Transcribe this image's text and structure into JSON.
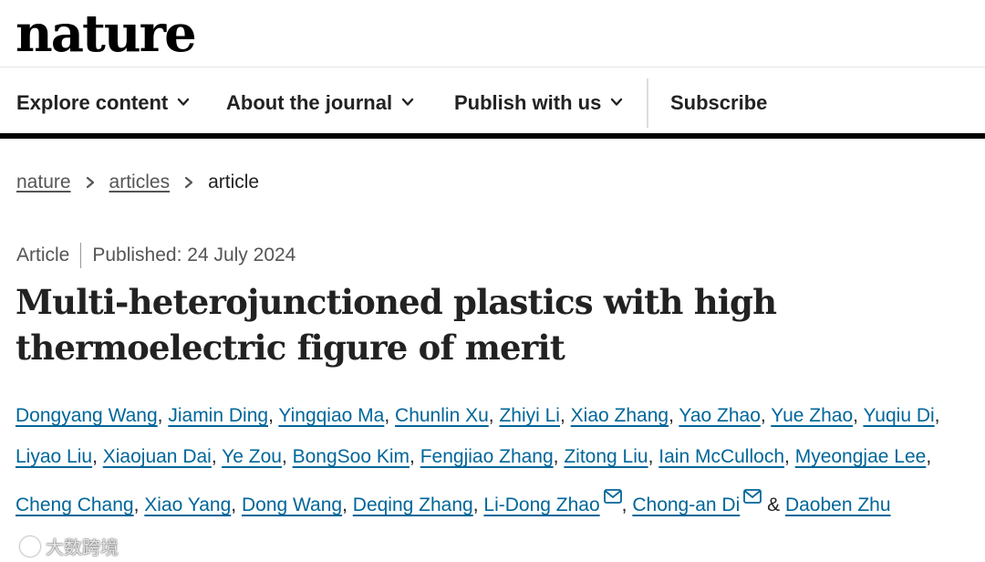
{
  "site": {
    "logo": "nature"
  },
  "nav": {
    "items": [
      {
        "label": "Explore content"
      },
      {
        "label": "About the journal"
      },
      {
        "label": "Publish with us"
      },
      {
        "label": "Subscribe"
      }
    ]
  },
  "breadcrumb": {
    "items": [
      "nature",
      "articles"
    ],
    "current": "article"
  },
  "article": {
    "type": "Article",
    "published": "Published: 24 July 2024",
    "title": "Multi-heterojunctioned plastics with high thermoelectric figure of merit",
    "authors": [
      "Dongyang Wang",
      "Jiamin Ding",
      "Yingqiao Ma",
      "Chunlin Xu",
      "Zhiyi Li",
      "Xiao Zhang",
      "Yao Zhao",
      "Yue Zhao",
      "Yuqiu Di",
      "Liyao Liu",
      "Xiaojuan Dai",
      "Ye Zou",
      "BongSoo Kim",
      "Fengjiao Zhang",
      "Zitong Liu",
      "Iain McCulloch",
      "Myeongjae Lee",
      "Cheng Chang",
      "Xiao Yang",
      "Dong Wang",
      "Deqing Zhang",
      "Li-Dong Zhao",
      "Chong-an Di",
      "Daoben Zhu"
    ],
    "separator": ",",
    "last_separator": "&"
  },
  "watermark": {
    "text": "大数跨境"
  },
  "colors": {
    "link": "#006699",
    "text": "#222222",
    "muted": "#555555"
  }
}
